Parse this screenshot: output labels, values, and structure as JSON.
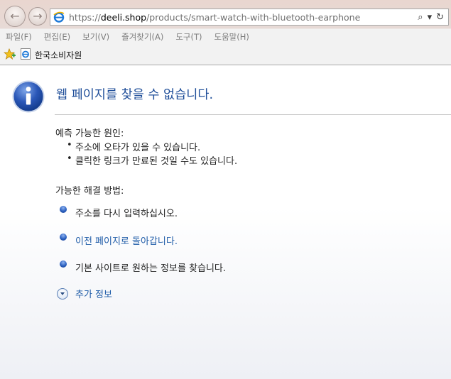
{
  "browser": {
    "url_prefix": "https://",
    "url_domain": "deeli.shop",
    "url_path": "/products/smart-watch-with-bluetooth-earphone",
    "search_glyph": "⌕",
    "dropdown_glyph": "▾",
    "refresh_glyph": "↻"
  },
  "menu": [
    "파일(F)",
    "편집(E)",
    "보기(V)",
    "즐겨찾기(A)",
    "도구(T)",
    "도움말(H)"
  ],
  "favorites": {
    "item_label": "한국소비자원"
  },
  "error_page": {
    "title": "웹 페이지를 찾을 수 없습니다.",
    "causes_heading": "예측 가능한 원인:",
    "causes": [
      "주소에 오타가 있을 수 있습니다.",
      "클릭한 링크가 만료된 것일 수도 있습니다."
    ],
    "solutions_heading": "가능한 해결 방법:",
    "solutions": [
      "주소를 다시 입력하십시오.",
      "이전 페이지로 돌아갑니다.",
      "기본 사이트로 원하는 정보를 찾습니다."
    ],
    "more_info": "추가 정보"
  },
  "colors": {
    "title": "#1f4e99",
    "link": "#1f5ca8"
  }
}
